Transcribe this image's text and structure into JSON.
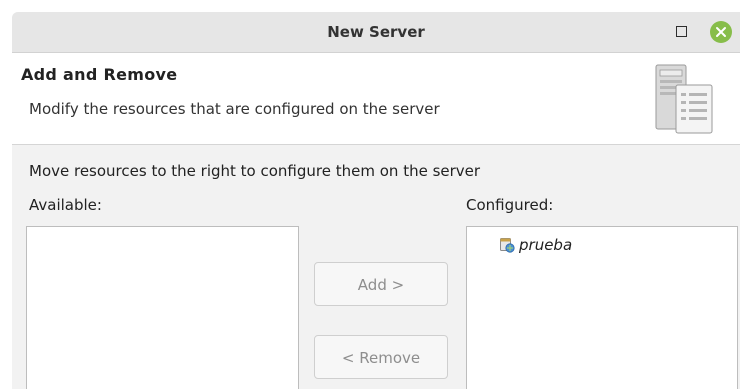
{
  "window": {
    "title": "New Server"
  },
  "header": {
    "title": "Add and Remove",
    "description": "Modify the resources that are configured on the server",
    "icon": "server-config-icon"
  },
  "body": {
    "instruction": "Move resources to the right to configure them on the server",
    "available_label": "Available:",
    "configured_label": "Configured:",
    "available_items": [],
    "configured_items": [
      {
        "label": "prueba",
        "icon": "web-project-icon"
      }
    ]
  },
  "buttons": {
    "add_label": "Add >",
    "remove_label": "< Remove"
  },
  "colors": {
    "close_button": "#87bd4a",
    "titlebar": "#e6e6e6",
    "disabled_text": "#8e8e8e"
  }
}
